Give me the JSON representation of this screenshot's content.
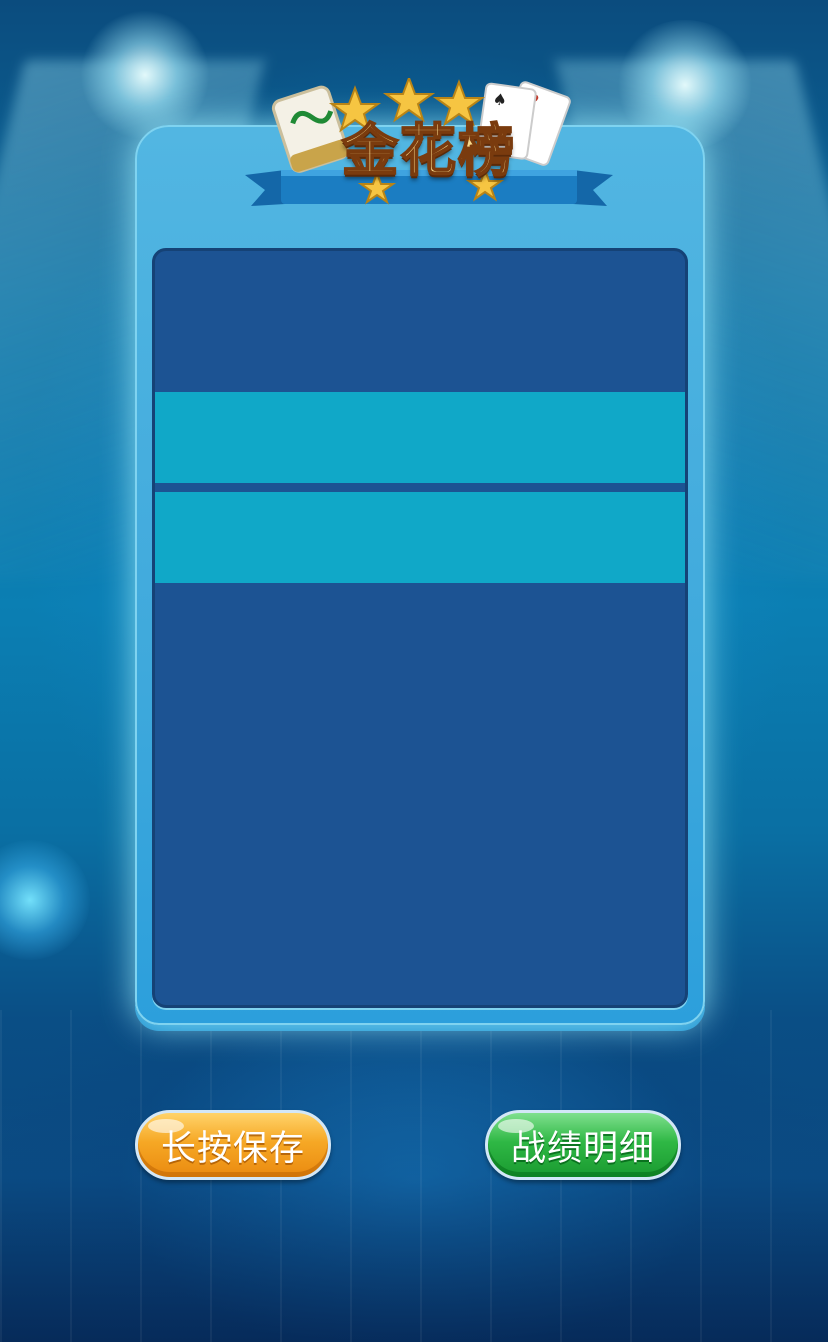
{
  "page": {
    "title": "金花榜"
  },
  "colors": {
    "card": "#3fa9dc",
    "card_inner": "#1c5393",
    "row_band": "#10a8c8",
    "title_text": "#f7d88a",
    "save_button": "#f6a825",
    "detail_button": "#2fb845"
  },
  "icons": {
    "badge": "mahjong-tile-stars-cards-icon"
  },
  "buttons": {
    "save_label": "长按保存",
    "detail_label": "战绩明细"
  }
}
